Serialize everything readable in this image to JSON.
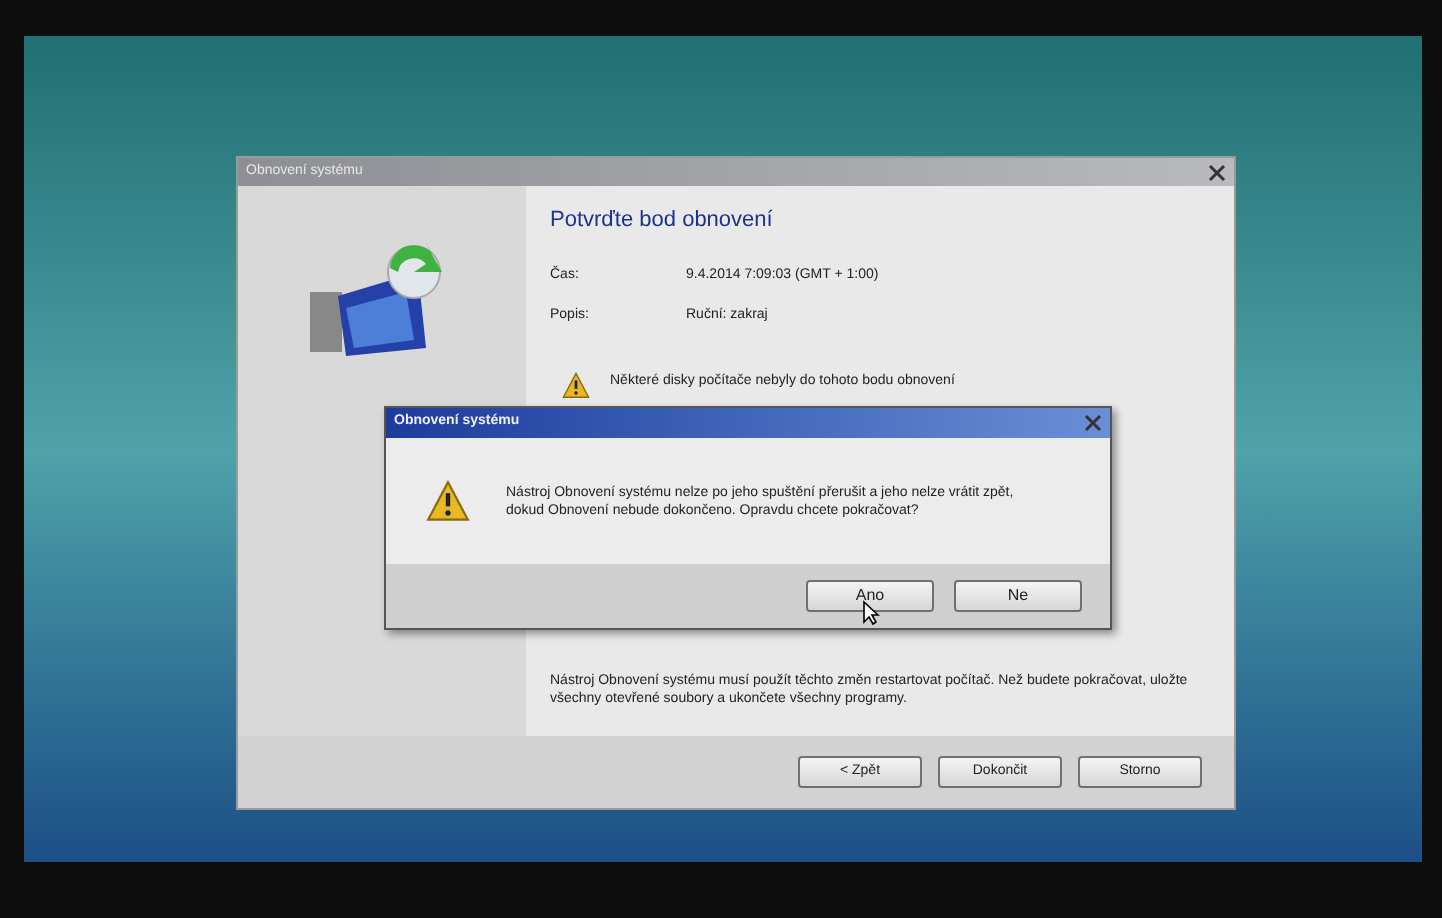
{
  "main_window": {
    "title": "Obnovení systému",
    "heading": "Potvrďte bod obnovení",
    "fields": [
      {
        "label": "Čas:",
        "value": "9.4.2014 7:09:03 (GMT + 1:00)"
      },
      {
        "label": "Popis:",
        "value": "Ruční: zakraj"
      }
    ],
    "warning": "Některé disky počítače nebyly do tohoto bodu obnovení",
    "notice": "Nástroj Obnovení systému musí použít těchto změn restartovat počítač. Než budete pokračovat, uložte všechny otevřené soubory a ukončete všechny programy.",
    "buttons": [
      "< Zpět",
      "Dokončit",
      "Storno"
    ]
  },
  "dialog": {
    "title": "Obnovení systému",
    "message": "Nástroj Obnovení systému nelze po jeho spuštění přerušit a jeho nelze vrátit zpět, dokud Obnovení nebude dokončeno. Opravdu chcete pokračovat?",
    "buttons": [
      "Ano",
      "Ne"
    ]
  }
}
